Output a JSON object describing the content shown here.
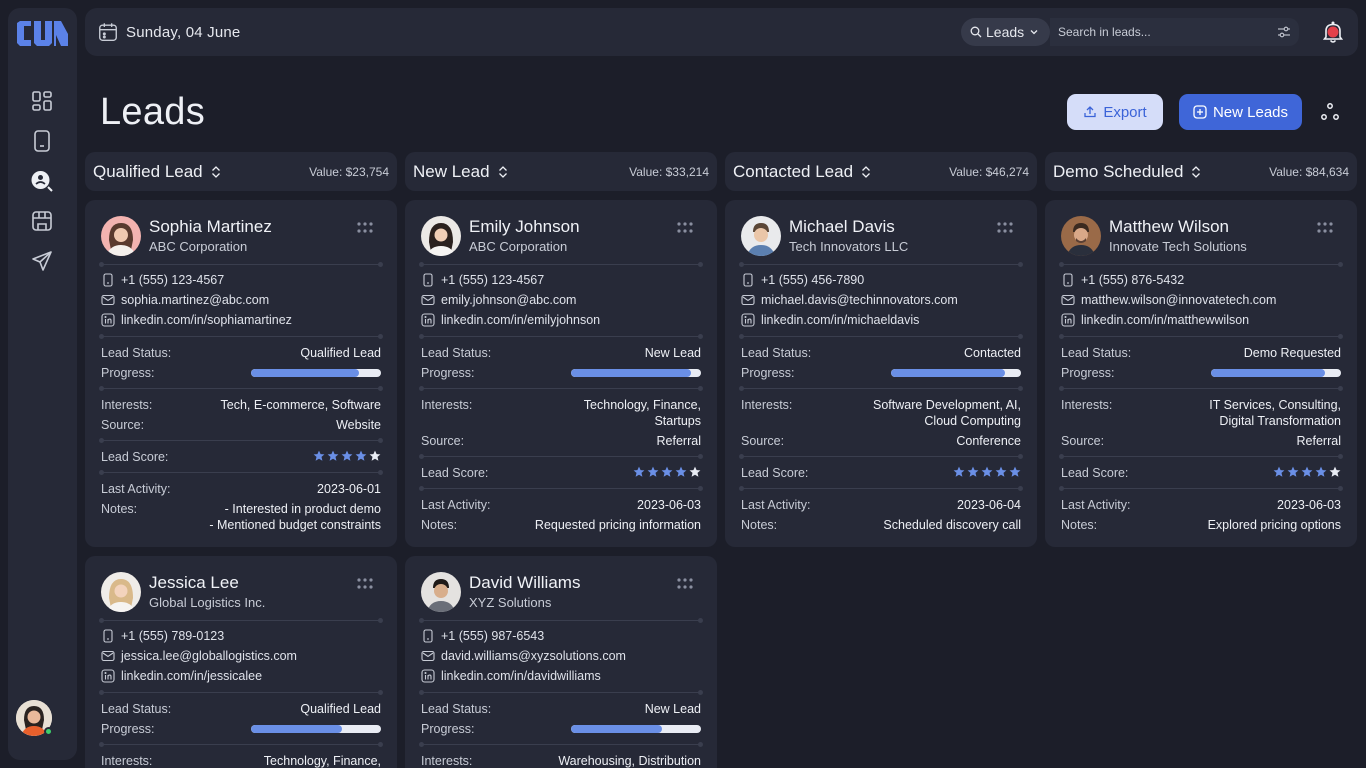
{
  "topbar": {
    "date": "Sunday, 04 June",
    "search_scope": "Leads",
    "search_placeholder": "Search in leads..."
  },
  "page": {
    "title": "Leads",
    "export_label": "Export",
    "new_label": "New Leads"
  },
  "columns": [
    {
      "title": "Qualified Lead",
      "value": "Value: $23,754"
    },
    {
      "title": "New Lead",
      "value": "Value: $33,214"
    },
    {
      "title": "Contacted Lead",
      "value": "Value: $46,274"
    },
    {
      "title": "Demo Scheduled",
      "value": "Value: $84,634"
    }
  ],
  "labels": {
    "status": "Lead Status:",
    "progress": "Progress:",
    "interests": "Interests:",
    "source": "Source:",
    "score": "Lead Score:",
    "activity": "Last Activity:",
    "notes": "Notes:"
  },
  "cards": [
    {
      "name": "Sophia Martinez",
      "company": "ABC Corporation",
      "phone": "+1 (555) 123-4567",
      "email": "sophia.martinez@abc.com",
      "linkedin": "linkedin.com/in/sophiamartinez",
      "status": "Qualified Lead",
      "progress": 0.83,
      "interests_1": "Tech, E-commerce, Software",
      "interests_2": "",
      "source": "Website",
      "score": 4,
      "activity": "2023-06-01",
      "notes_1": "- Interested in product demo",
      "notes_2": "- Mentioned budget constraints"
    },
    {
      "name": "Emily Johnson",
      "company": "ABC Corporation",
      "phone": "+1 (555) 123-4567",
      "email": "emily.johnson@abc.com",
      "linkedin": "linkedin.com/in/emilyjohnson",
      "status": "New Lead",
      "progress": 0.92,
      "interests_1": "Technology, Finance,",
      "interests_2": "Startups",
      "source": "Referral",
      "score": 4,
      "activity": "2023-06-03",
      "notes_1": "Requested pricing information",
      "notes_2": ""
    },
    {
      "name": "Michael Davis",
      "company": "Tech Innovators LLC",
      "phone": "+1 (555) 456-7890",
      "email": "michael.davis@techinnovators.com",
      "linkedin": "linkedin.com/in/michaeldavis",
      "status": "Contacted",
      "progress": 0.88,
      "interests_1": "Software Development, AI,",
      "interests_2": "Cloud Computing",
      "source": "Conference",
      "score": 5,
      "activity": "2023-06-04",
      "notes_1": "Scheduled discovery call",
      "notes_2": ""
    },
    {
      "name": "Matthew Wilson",
      "company": "Innovate Tech Solutions",
      "phone": "+1 (555) 876-5432",
      "email": "matthew.wilson@innovatetech.com",
      "linkedin": "linkedin.com/in/matthewwilson",
      "status": "Demo Requested",
      "progress": 0.88,
      "interests_1": "IT Services, Consulting,",
      "interests_2": "Digital Transformation",
      "source": "Referral",
      "score": 4,
      "activity": "2023-06-03",
      "notes_1": "Explored pricing options",
      "notes_2": ""
    },
    {
      "name": "Jessica Lee",
      "company": "Global Logistics Inc.",
      "phone": "+1 (555) 789-0123",
      "email": "jessica.lee@globallogistics.com",
      "linkedin": "linkedin.com/in/jessicalee",
      "status": "Qualified Lead",
      "progress": 0.7,
      "interests_1": "Technology, Finance,",
      "interests_2": ""
    },
    {
      "name": "David Williams",
      "company": "XYZ Solutions",
      "phone": "+1 (555) 987-6543",
      "email": "david.williams@xyzsolutions.com",
      "linkedin": "linkedin.com/in/davidwilliams",
      "status": "New Lead",
      "progress": 0.7,
      "interests_1": "Warehousing, Distribution",
      "interests_2": ""
    }
  ],
  "colors": {
    "background": "#1c1e29",
    "panel": "#262937",
    "accent": "#3f66d8",
    "progress_fill": "#6a8fe6",
    "star_filled": "#6a8fe6",
    "star_empty": "#e9ecf4"
  }
}
